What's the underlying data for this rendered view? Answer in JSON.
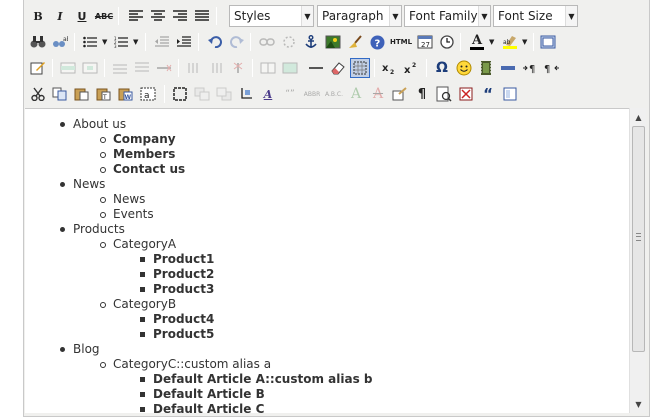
{
  "toolbar": {
    "styles": "Styles",
    "format": "Paragraph",
    "font_family": "Font Family",
    "font_size": "Font Size",
    "bold_glyph": "B",
    "italic_glyph": "I",
    "underline_glyph": "U",
    "strike_glyph": "ABC",
    "html_glyph": "HTML",
    "omega_glyph": "Ω",
    "pilcrow_glyph": "¶",
    "font_color_glyph": "A"
  },
  "content": {
    "items": [
      {
        "level": 1,
        "text": "About us",
        "bold": false
      },
      {
        "level": 2,
        "text": "Company",
        "bold": true
      },
      {
        "level": 2,
        "text": "Members",
        "bold": true
      },
      {
        "level": 2,
        "text": "Contact us",
        "bold": true
      },
      {
        "level": 1,
        "text": "News",
        "bold": false
      },
      {
        "level": 2,
        "text": "News",
        "bold": false
      },
      {
        "level": 2,
        "text": "Events",
        "bold": false
      },
      {
        "level": 1,
        "text": "Products",
        "bold": false
      },
      {
        "level": 2,
        "text": "CategoryA",
        "bold": false
      },
      {
        "level": 3,
        "text": "Product1",
        "bold": true
      },
      {
        "level": 3,
        "text": "Product2",
        "bold": true
      },
      {
        "level": 3,
        "text": "Product3",
        "bold": true
      },
      {
        "level": 2,
        "text": "CategoryB",
        "bold": false
      },
      {
        "level": 3,
        "text": "Product4",
        "bold": true
      },
      {
        "level": 3,
        "text": "Product5",
        "bold": true
      },
      {
        "level": 1,
        "text": "Blog",
        "bold": false
      },
      {
        "level": 2,
        "text": "CategoryC::custom alias a",
        "bold": false
      },
      {
        "level": 3,
        "text": "Default Article A::custom alias b",
        "bold": true
      },
      {
        "level": 3,
        "text": "Default Article B",
        "bold": true
      },
      {
        "level": 3,
        "text": "Default Article C",
        "bold": true
      }
    ]
  }
}
